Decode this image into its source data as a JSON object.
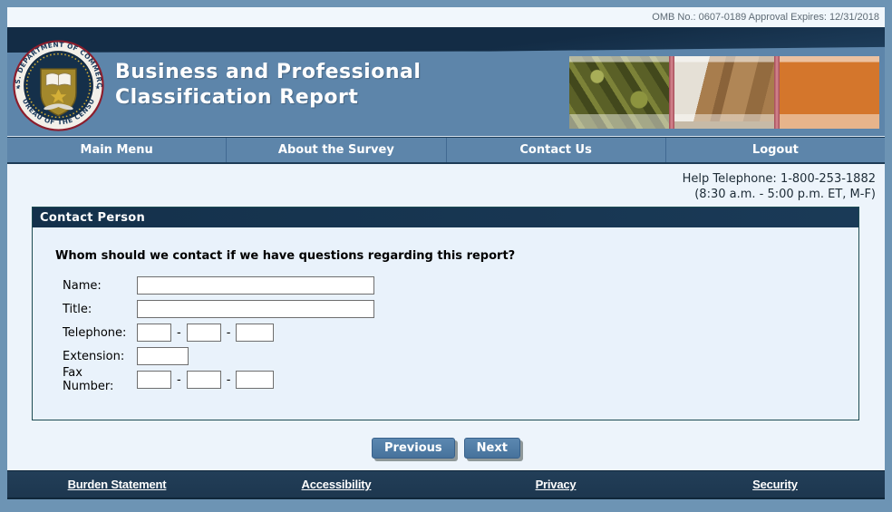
{
  "omb": {
    "text": "OMB No.: 0607-0189 Approval Expires: 12/31/2018"
  },
  "header": {
    "title_line1": "Business and Professional",
    "title_line2": "Classification Report",
    "seal": {
      "top_text": "U.S. DEPARTMENT OF COMMERCE",
      "bottom_text": "BUREAU OF THE CENSUS"
    },
    "photos": [
      "machine-parts-photo",
      "shipping-boxes-photo",
      "oranges-photo"
    ]
  },
  "nav": {
    "items": [
      {
        "label": "Main Menu"
      },
      {
        "label": "About the Survey"
      },
      {
        "label": "Contact Us"
      },
      {
        "label": "Logout"
      }
    ]
  },
  "help": {
    "line1": "Help Telephone: 1-800-253-1882",
    "line2": "(8:30 a.m. - 5:00 p.m. ET, M-F)"
  },
  "panel": {
    "title": "Contact Person",
    "question": "Whom should we contact if we have questions regarding this report?",
    "dash": "-",
    "fields": [
      {
        "label": "Name:",
        "value": ""
      },
      {
        "label": "Title:",
        "value": ""
      },
      {
        "label": "Telephone:",
        "values": [
          "",
          "",
          ""
        ]
      },
      {
        "label": "Extension:",
        "value": ""
      },
      {
        "label": "Fax Number:",
        "values": [
          "",
          "",
          ""
        ]
      }
    ]
  },
  "buttons": {
    "previous": "Previous",
    "next": "Next"
  },
  "footer": {
    "links": [
      {
        "label": "Burden Statement"
      },
      {
        "label": "Accessibility"
      },
      {
        "label": "Privacy"
      },
      {
        "label": "Security"
      }
    ]
  },
  "theme": {
    "frame": "#6d94b4",
    "header_band": "#5d85aa",
    "dark_navy": "#14314b",
    "content_bg": "#edf4fb",
    "panel_border": "#1d4b52",
    "button_blue": "#4f7ca8",
    "photo_separator": "#c46a72"
  }
}
